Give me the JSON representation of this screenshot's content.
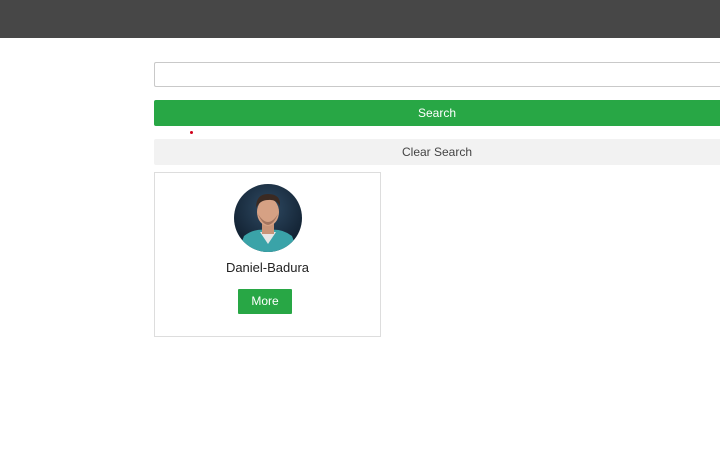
{
  "search": {
    "input_value": "",
    "placeholder": "",
    "search_label": "Search",
    "clear_label": "Clear Search"
  },
  "results": [
    {
      "name": "Daniel-Badura",
      "more_label": "More",
      "avatar_icon": "person-photo"
    }
  ],
  "colors": {
    "topbar": "#474747",
    "accent_green": "#28a745",
    "clear_bg": "#f2f2f2"
  }
}
